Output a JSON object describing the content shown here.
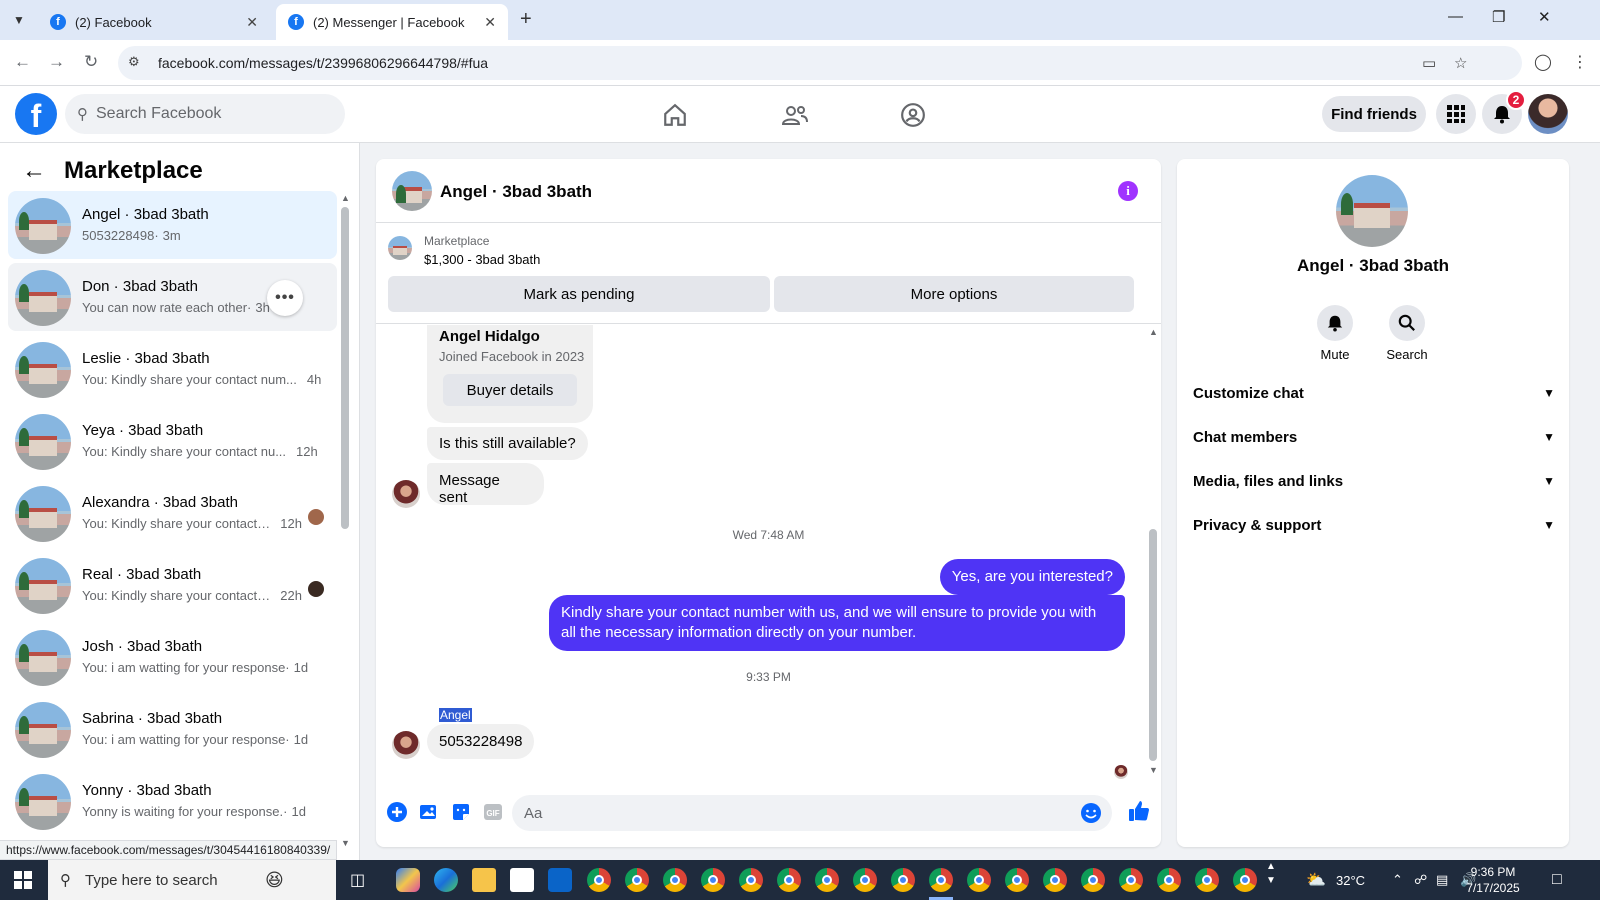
{
  "browser": {
    "tabs": [
      {
        "title": "(2) Facebook",
        "active": false
      },
      {
        "title": "(2) Messenger | Facebook",
        "active": true
      }
    ],
    "url": "facebook.com/messages/t/23996806296644798/#fua",
    "status_url": "https://www.facebook.com/messages/t/30454416180840339/"
  },
  "header": {
    "logo": "f",
    "search_placeholder": "Search Facebook",
    "find_friends": "Find friends",
    "notification_count": "2"
  },
  "sidebar": {
    "title": "Marketplace",
    "conversations": [
      {
        "name": "Angel · 3bad 3bath",
        "preview": "5053228498",
        "time": "3m",
        "selected": true
      },
      {
        "name": "Don · 3bad 3bath",
        "preview": "You can now rate each other",
        "time": "3h",
        "hover": true
      },
      {
        "name": "Leslie · 3bad 3bath",
        "preview": "You: Kindly share your contact num...",
        "time": "4h"
      },
      {
        "name": "Yeya · 3bad 3bath",
        "preview": "You: Kindly share your contact nu...",
        "time": "12h"
      },
      {
        "name": "Alexandra · 3bad 3bath",
        "preview": "You: Kindly share your contact ...",
        "time": "12h"
      },
      {
        "name": "Real · 3bad 3bath",
        "preview": "You: Kindly share your contact ...",
        "time": "22h"
      },
      {
        "name": "Josh · 3bad 3bath",
        "preview": "You: i am watting for your response",
        "time": "1d"
      },
      {
        "name": "Sabrina · 3bad 3bath",
        "preview": "You: i am watting for your response",
        "time": "1d"
      },
      {
        "name": "Yonny · 3bad 3bath",
        "preview": "Yonny is waiting for your response.",
        "time": "1d"
      }
    ]
  },
  "chat": {
    "title": "Angel · 3bad 3bath",
    "marketplace_label": "Marketplace",
    "listing": "$1,300 - 3bad 3bath",
    "mark_pending": "Mark as pending",
    "more_options": "More options",
    "buyer_card": {
      "name": "Angel Hidalgo",
      "joined": "Joined Facebook in 2023",
      "button": "Buyer details"
    },
    "messages": {
      "still_available": "Is this still available?",
      "message_sent": "Message sent",
      "stamp1": "Wed 7:48 AM",
      "reply1": "Yes, are you interested?",
      "reply2": "Kindly share your contact number with us, and we will ensure to provide you with all the necessary information directly on your number.",
      "stamp2": "9:33 PM",
      "sender_label": "Angel",
      "incoming_number": "5053228498"
    },
    "composer_placeholder": "Aa"
  },
  "rpanel": {
    "name": "Angel · 3bad 3bath",
    "mute": "Mute",
    "search": "Search",
    "sections": [
      "Customize chat",
      "Chat members",
      "Media, files and links",
      "Privacy & support"
    ]
  },
  "taskbar": {
    "search_placeholder": "Type here to search",
    "temperature": "32°C",
    "time": "9:36 PM",
    "date": "7/17/2025"
  }
}
